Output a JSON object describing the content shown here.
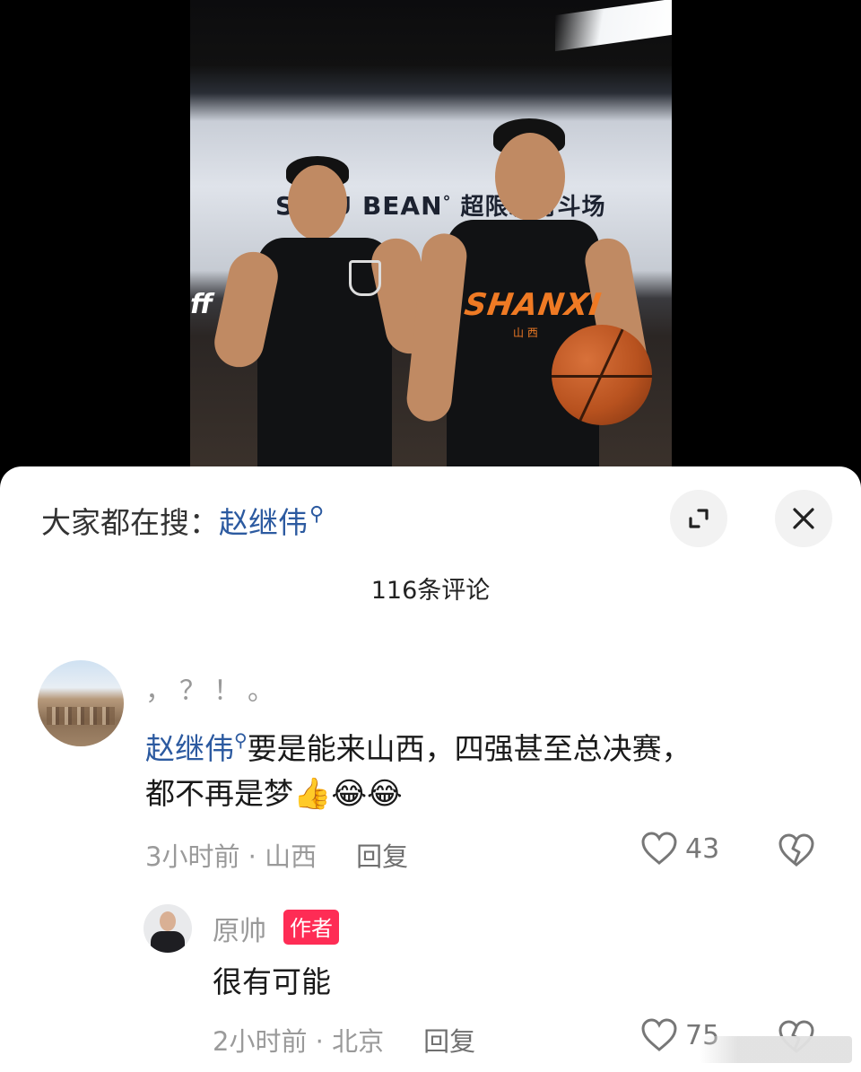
{
  "video": {
    "wall_sign_left": "S",
    "wall_sign_brand": "ZU BEAN",
    "wall_sign_cn": "超限凝时斗场",
    "left_sign": "ff",
    "jersey_text": "SHANXI",
    "jersey_sub": "山 西"
  },
  "sheet": {
    "search_prefix": "大家都在搜：",
    "search_keyword": "赵继伟",
    "comment_count": "116条评论"
  },
  "comments": [
    {
      "username": "，？！。",
      "mention": "赵继伟",
      "text_line1": "要是能来山西，四强甚至总决赛，",
      "text_line2": "都不再是梦",
      "emojis": "👍😂😂",
      "time_location": "3小时前 · 山西",
      "reply_label": "回复",
      "likes": "43"
    },
    {
      "username": "原帅",
      "badge": "作者",
      "text": "很有可能",
      "time_location": "2小时前 · 北京",
      "reply_label": "回复",
      "likes": "75"
    }
  ],
  "icons": {
    "expand": "expand-icon",
    "close": "close-icon",
    "heart": "heart-icon",
    "broken_heart": "broken-heart-icon"
  },
  "colors": {
    "keyword": "#2c5aa0",
    "badge": "#fe2c55",
    "meta": "#9a9a9a"
  }
}
